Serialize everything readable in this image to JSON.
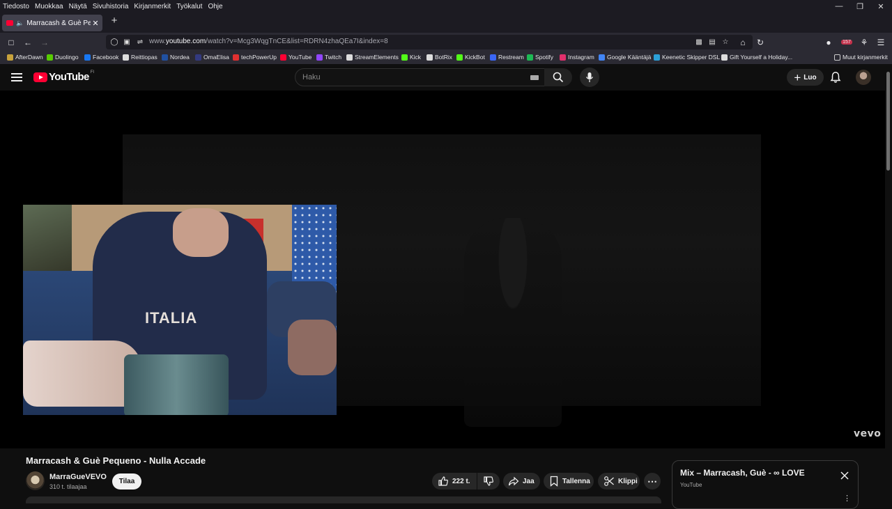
{
  "menubar": {
    "items": [
      "Tiedosto",
      "Muokkaa",
      "Näytä",
      "Sivuhistoria",
      "Kirjanmerkit",
      "Työkalut",
      "Ohje"
    ]
  },
  "tab": {
    "title": "Marracash & Guè Pequeno",
    "favicon": "youtube-icon",
    "playing": "speaker-icon"
  },
  "navbar": {
    "url_prefix": "www.",
    "url_domain": "youtube.com",
    "url_rest": "/watch?v=Mcg3WqgTnCE&list=RDRN4zhaQEa7I&index=8",
    "extension_badge": "157"
  },
  "bookmarks": [
    {
      "label": "AfterDawn",
      "color": "#c7a23c"
    },
    {
      "label": "Duolingo",
      "color": "#58cc02"
    },
    {
      "label": "Facebook",
      "color": "#1877f2"
    },
    {
      "label": "Reittiopas",
      "color": "#dddddd"
    },
    {
      "label": "Nordea",
      "color": "#2050a0"
    },
    {
      "label": "OmaElisa",
      "color": "#333a80"
    },
    {
      "label": "techPowerUp",
      "color": "#e03030"
    },
    {
      "label": "YouTube",
      "color": "#ff0033"
    },
    {
      "label": "Twitch",
      "color": "#9146ff"
    },
    {
      "label": "StreamElements",
      "color": "#dddddd"
    },
    {
      "label": "Kick",
      "color": "#53fc18"
    },
    {
      "label": "BotRix",
      "color": "#dddddd"
    },
    {
      "label": "KickBot",
      "color": "#53fc18"
    },
    {
      "label": "Restream",
      "color": "#3a66f5"
    },
    {
      "label": "Spotify",
      "color": "#1db954"
    },
    {
      "label": "Instagram",
      "color": "#e1306c"
    },
    {
      "label": "Google Kääntäjä",
      "color": "#4285f4"
    },
    {
      "label": "Keenetic Skipper DSL",
      "color": "#2ba0d8"
    },
    {
      "label": "Gift Yourself a Holiday...",
      "color": "#dddddd"
    }
  ],
  "bookmarks_other": "Muut kirjanmerkit",
  "youtube": {
    "logo_text": "YouTube",
    "region": "FI",
    "search_placeholder": "Haku",
    "create_label": "Luo",
    "accent": "#ff0033"
  },
  "player": {
    "watermark": "vevo"
  },
  "video": {
    "title": "Marracash & Guè Pequeno - Nulla Accade",
    "channel": "MarraGueVEVO",
    "subscribers": "310 t. tilaajaa",
    "subscribe_label": "Tilaa",
    "likes": "222 t.",
    "share_label": "Jaa",
    "save_label": "Tallenna",
    "clip_label": "Klippi"
  },
  "mix": {
    "title": "Mix – Marracash, Guè - ∞ LOVE",
    "source": "YouTube"
  }
}
